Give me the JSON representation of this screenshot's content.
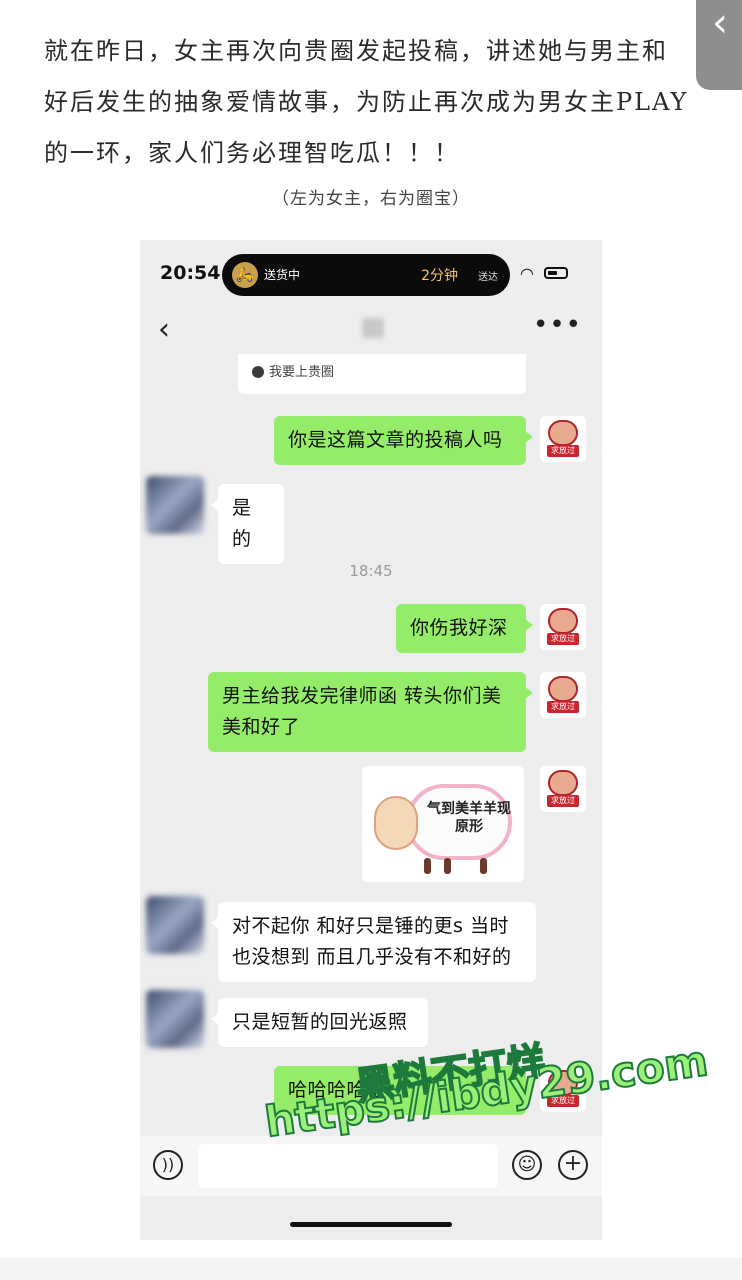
{
  "article": {
    "lines": [
      "就在昨日，女主再次向贵圈发起投稿，讲述她与男主和",
      "好后发生的抽象爱情故事，为防止再次成为男女主PLAY",
      "的一环，家人们务必理智吃瓜！！！"
    ],
    "caption": "（左为女主，右为圈宝）"
  },
  "status_bar": {
    "time": "20:54",
    "island_left": "送货中",
    "island_minutes": "2分钟",
    "island_right": "送达"
  },
  "card": {
    "text": "我要上贵圈"
  },
  "messages": [
    {
      "side": "right",
      "text": "你是这篇文章的投稿人吗"
    },
    {
      "side": "left",
      "text": "是的"
    },
    {
      "side": "right",
      "text": "你伤我好深"
    },
    {
      "side": "right",
      "text": "男主给我发完律师函 转头你们美美和好了"
    },
    {
      "side": "right",
      "type": "sticker",
      "text": "气到美羊羊现原形"
    },
    {
      "side": "left",
      "text": "对不起你 和好只是锤的更s 当时也没想到 而且几乎没有不和好的"
    },
    {
      "side": "left",
      "text": "只是短暂的回光返照"
    },
    {
      "side": "right",
      "text": "哈哈哈哈哈"
    }
  ],
  "timestamp": "18:45",
  "avatar_tag": "求放过",
  "icons": {
    "back": "back-chevron-icon",
    "more": "more-dots-icon",
    "voice": "voice-icon",
    "emoji": "emoji-icon",
    "plus": "plus-icon",
    "wifi": "wifi-icon",
    "battery": "battery-icon"
  },
  "watermark": {
    "cn": "黑料不打烊",
    "url": "https://ibdy29.com"
  },
  "colors": {
    "green_bubble": "#95ec69",
    "chat_bg": "#ededed",
    "watermark": "#9cf07a"
  }
}
